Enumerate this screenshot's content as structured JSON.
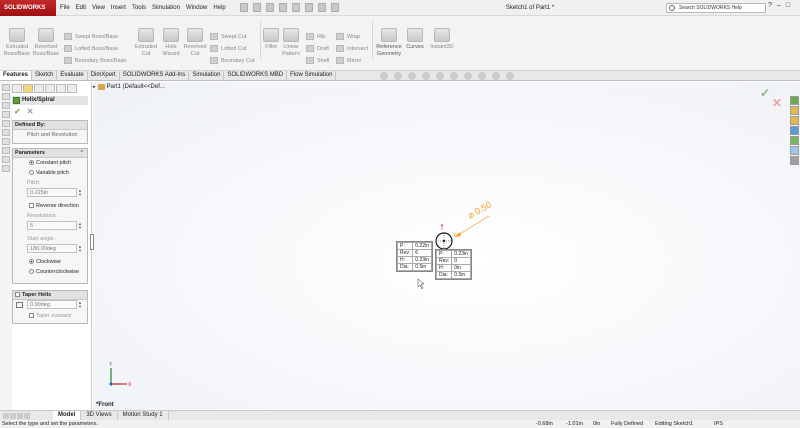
{
  "app": {
    "logo": "SOLIDWORKS",
    "menu": [
      "File",
      "Edit",
      "View",
      "Insert",
      "Tools",
      "Simulation",
      "Window",
      "Help"
    ],
    "doc_title": "Sketch1 of Part1 *",
    "search_placeholder": "Search SOLIDWORKS Help",
    "window_buttons": [
      "?",
      "–",
      "□"
    ]
  },
  "ribbon": {
    "extruded_boss": "Extruded\nBoss/Base",
    "revolved_boss": "Revolved\nBoss/Base",
    "swept_boss": "Swept Boss/Base",
    "lofted_boss": "Lofted Boss/Base",
    "boundary_boss": "Boundary Boss/Base",
    "extruded_cut": "Extruded\nCut",
    "hole_wizard": "Hole\nWizard",
    "revolved_cut": "Revolved\nCut",
    "swept_cut": "Swept Cut",
    "lofted_cut": "Lofted Cut",
    "boundary_cut": "Boundary Cut",
    "fillet": "Fillet",
    "linear_pattern": "Linear\nPattern",
    "rib": "Rib",
    "draft": "Draft",
    "shell": "Shell",
    "wrap": "Wrap",
    "intersect": "Intersect",
    "mirror": "Mirror",
    "reference_geometry": "Reference\nGeometry",
    "curves": "Curves",
    "instant3d": "Instant3D"
  },
  "command_tabs": [
    "Features",
    "Sketch",
    "Evaluate",
    "DimXpert",
    "SOLIDWORKS Add-Ins",
    "Simulation",
    "SOLIDWORKS MBD",
    "Flow Simulation"
  ],
  "active_command_tab": "Features",
  "property_manager": {
    "title": "Helix/Spiral",
    "defined_by": {
      "heading": "Defined By:",
      "value": "Pitch and Revolution"
    },
    "parameters": {
      "heading": "Parameters",
      "constant_pitch": "Constant pitch",
      "variable_pitch": "Variable pitch",
      "pitch_label": "Pitch:",
      "pitch_value": "0.225in",
      "reverse_direction": "Reverse direction",
      "revolutions_label": "Revolutions:",
      "revolutions_value": "5",
      "start_angle_label": "Start angle:",
      "start_angle_value": "180.00deg",
      "clockwise": "Clockwise",
      "counterclockwise": "Counterclockwise"
    },
    "taper": {
      "heading": "Taper Helix",
      "angle_value": "0.00deg",
      "taper_outward": "Taper outward"
    }
  },
  "tree": {
    "root": "Part1  (Default<<Def..."
  },
  "readout_left": {
    "rows": [
      {
        "k": "P:",
        "v": "0.22in"
      },
      {
        "k": "Rev:",
        "v": "6"
      },
      {
        "k": "H:",
        "v": "0.23in"
      },
      {
        "k": "Dia:",
        "v": "0.5in"
      }
    ]
  },
  "readout_right": {
    "rows": [
      {
        "k": "P:",
        "v": "0.23in"
      },
      {
        "k": "Rev:",
        "v": "0"
      },
      {
        "k": "H:",
        "v": "0in"
      },
      {
        "k": "Dia:",
        "v": "0.5in"
      }
    ]
  },
  "dimension": "⌀ 0.50",
  "view_label": "*Front",
  "bottom_tabs": [
    "Model",
    "3D Views",
    "Motion Study 1"
  ],
  "active_bottom_tab": "Model",
  "status": {
    "message": "Select the type and set the parameters.",
    "x": "-0.68in",
    "y": "-1.01in",
    "z": "0in",
    "state": "Fully Defined",
    "editing": "Editing Sketch1",
    "units": "IPS"
  },
  "colors": {
    "accent_red": "#b01c1c",
    "ok_green": "#4a9b34",
    "dimension_orange": "#f0a020"
  }
}
